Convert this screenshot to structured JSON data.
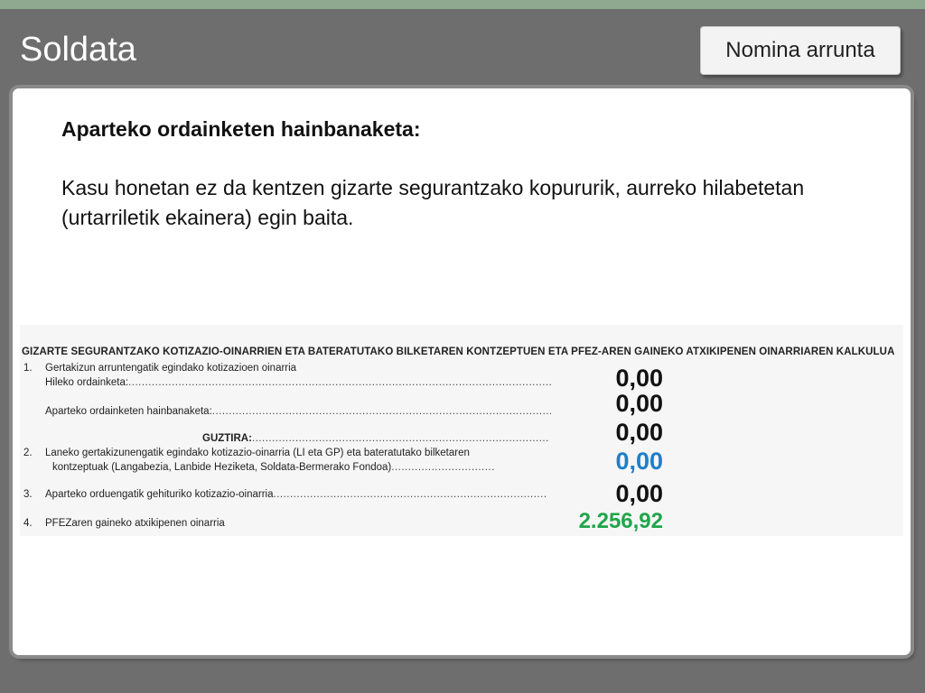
{
  "header": {
    "title": "Soldata",
    "nav_button_label": "Nomina arrunta"
  },
  "content": {
    "heading": "Aparteko ordainketen hainbanaketa:",
    "paragraph": "Kasu honetan ez da kentzen gizarte segurantzako kopururik, aurreko hilabetetan (urtarriletik ekainera) egin baita."
  },
  "form": {
    "header": "GIZARTE SEGURANTZAKO KOTIZAZIO-OINARRIEN ETA BATERATUTAKO BILKETAREN KONTZEPTUEN ETA PFEZ-AREN GAINEKO ATXIKIPENEN OINARRIAREN KALKULUA",
    "rows": [
      {
        "num": "1.",
        "label": "Gertakizun arruntengatik egindako kotizazioen oinarria",
        "dots": ""
      },
      {
        "num": "",
        "label": "Hileko ordainketa:",
        "dots": ".........................................................................................................................................................."
      },
      {
        "num": "",
        "label": "Aparteko ordainketen hainbanaketa:",
        "dots": ".........................................................................................................."
      },
      {
        "num": "",
        "label": "GUZTIRA:",
        "dots": ".........................................................................................."
      },
      {
        "num": "2.",
        "label": "Laneko gertakizunengatik egindako kotizazio-oinarria (LI eta GP) eta bateratutako bilketaren",
        "dots": ""
      },
      {
        "num": "",
        "label": "kontzeptuak (Langabezia, Lanbide Heziketa, Soldata-Bermerako Fondoa)",
        "dots": "..............................."
      },
      {
        "num": "3.",
        "label": "Aparteko orduengatik gehituriko kotizazio-oinarria",
        "dots": ".................................................................................."
      },
      {
        "num": "4.",
        "label": "PFEZaren gaineko atxikipenen oinarria",
        "dots": ""
      }
    ],
    "values": [
      "0,00",
      "0,00",
      "0,00",
      "0,00",
      "0,00",
      "2.256,92"
    ]
  },
  "colors": {
    "blue_value": "#1f7fc7",
    "green_value": "#1fa64a"
  }
}
